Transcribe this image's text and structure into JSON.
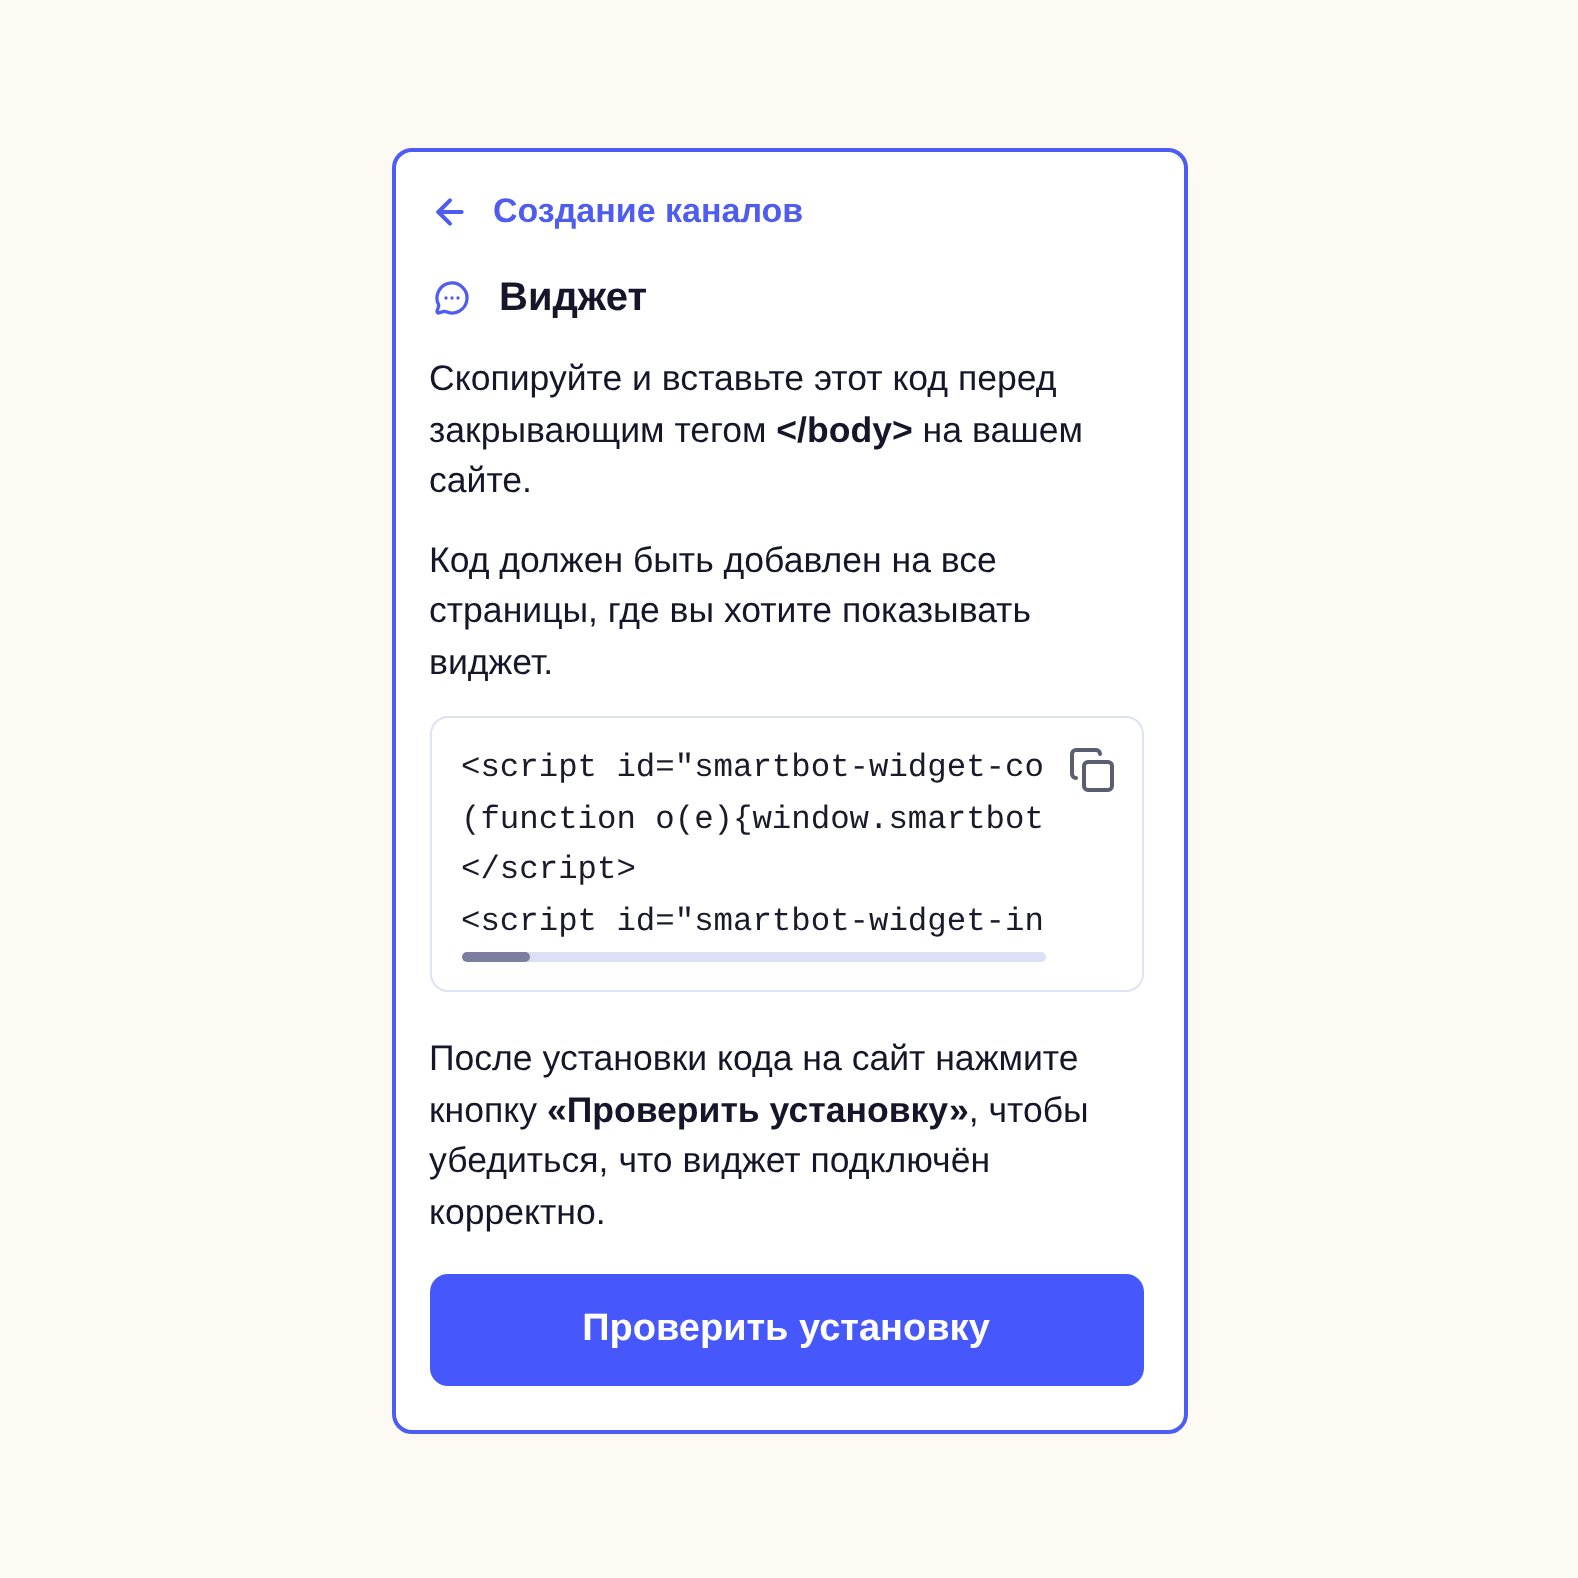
{
  "back_link": {
    "label": "Создание каналов"
  },
  "header": {
    "title": "Виджет"
  },
  "instructions": [
    "Скопируйте и вставьте этот код перед закрывающим тегом **</body>** на вашем сайте.",
    "Код должен быть добавлен на все страницы, где вы хотите показывать виджет."
  ],
  "code_block": {
    "lines": [
      "<script id=\"smartbot-widget-co",
      "(function o(e){window.smartbot",
      "</script>",
      "<script id=\"smartbot-widget-in"
    ]
  },
  "note": "После установки кода на сайт нажмите кнопку **«Проверить установку»**, чтобы убедиться, что виджет подключён корректно.",
  "button": {
    "label": "Проверить установку"
  }
}
